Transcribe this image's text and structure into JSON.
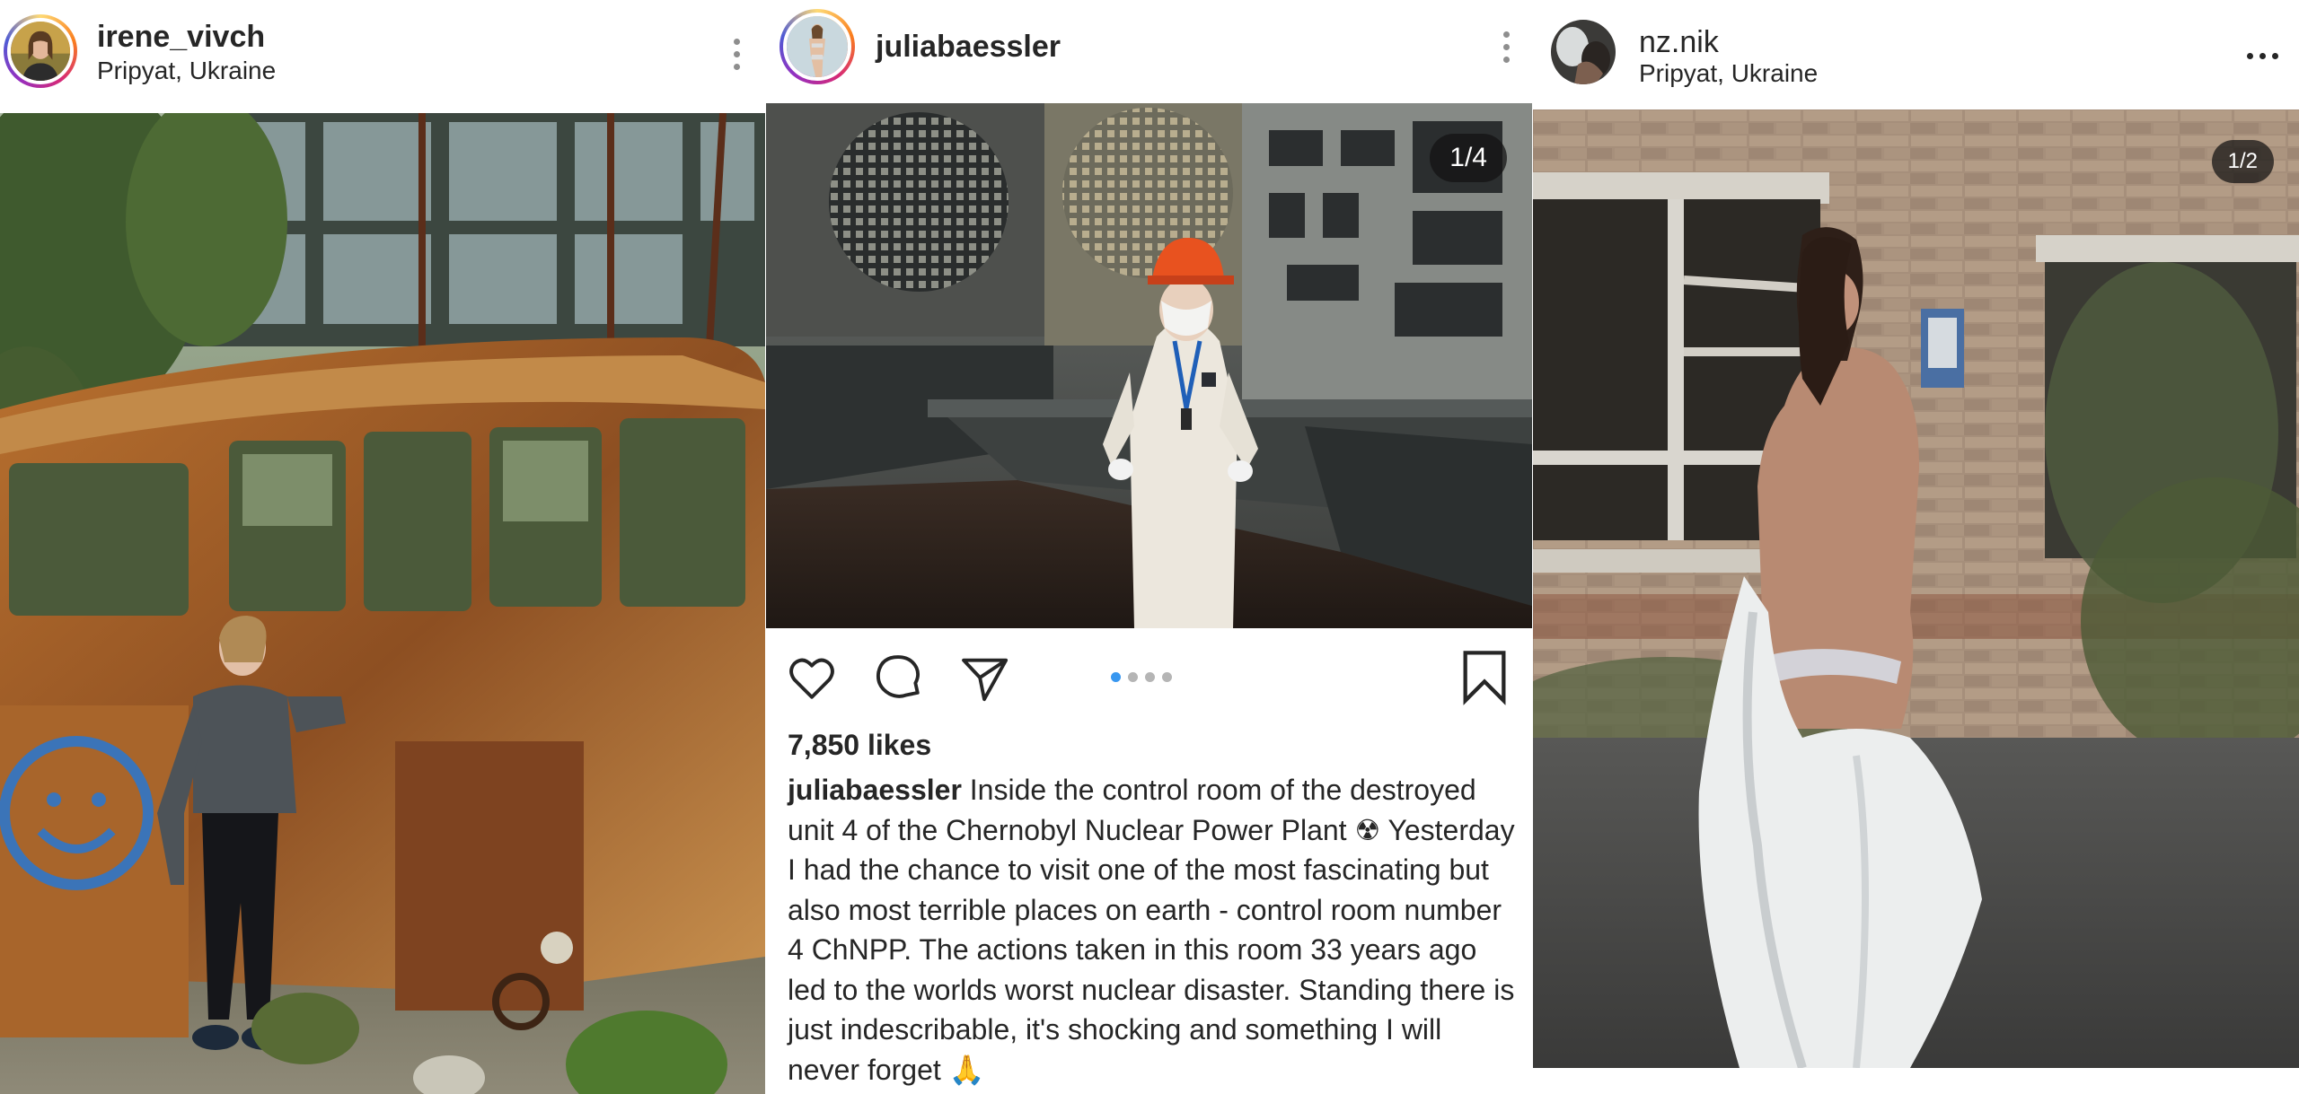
{
  "posts": [
    {
      "username": "irene_vivch",
      "location": "Pripyat, Ukraine",
      "more_icon": "more-vertical-icon"
    },
    {
      "username": "juliabaessler",
      "media_counter": "1/4",
      "carousel": {
        "total": 4,
        "active_index": 0
      },
      "actions": [
        "heart-icon",
        "comment-icon",
        "share-icon",
        "bookmark-icon"
      ],
      "likes": "7,850 likes",
      "caption_user": "juliabaessler",
      "caption_text": "Inside the control room of the destroyed unit 4 of the Chernobyl Nuclear Power Plant ☢ Yesterday I had the chance to visit one of the most fascinating but also most terrible places on earth - control room number 4 ChNPP. The actions taken in this room 33 years ago led to the worlds worst nuclear disaster. Standing there is just indescribable, it's shocking and something I will never forget 🙏",
      "more_icon": "more-vertical-icon"
    },
    {
      "username": "nz.nik",
      "location": "Pripyat, Ukraine",
      "media_counter": "1/2",
      "more_icon": "more-horizontal-icon"
    }
  ],
  "colors": {
    "text": "#262626",
    "active_dot": "#3897f0",
    "inactive_dot": "#b5b5b5",
    "counter_bg": "#121212",
    "avatar_ring": "#d62976"
  }
}
